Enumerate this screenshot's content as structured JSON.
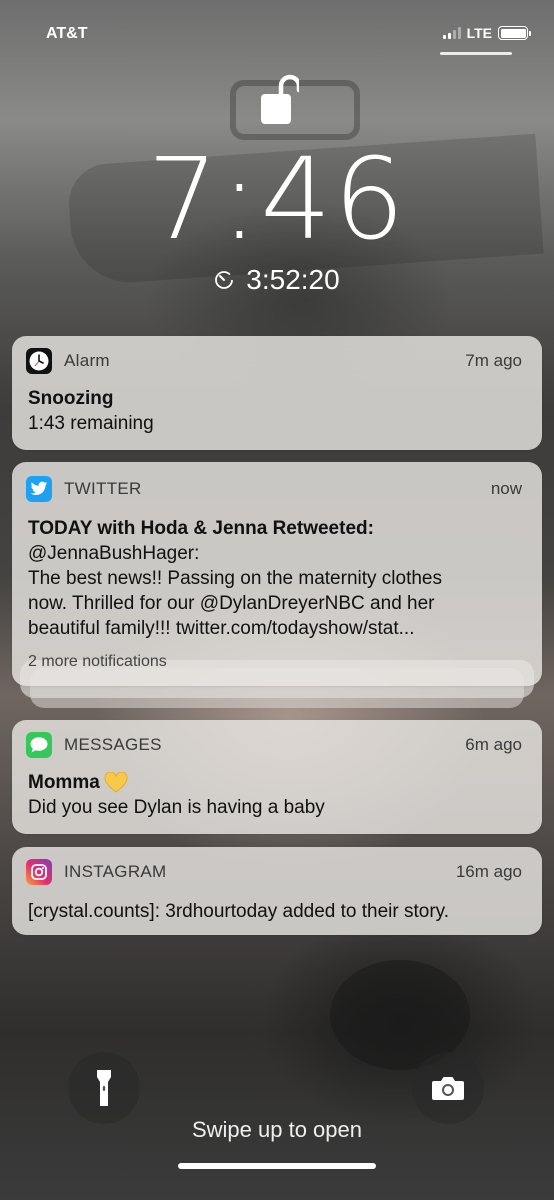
{
  "status_bar": {
    "carrier": "AT&T",
    "network": "LTE",
    "battery_level": 1.0
  },
  "lock_screen": {
    "lock_icon": "unlocked-padlock-icon",
    "time": "7:46",
    "timer_icon": "timer-icon",
    "timer": "3:52:20"
  },
  "notifications": [
    {
      "app": "Alarm",
      "icon": "clock-icon",
      "time": "7m ago",
      "title": "Snoozing",
      "lines": [
        "1:43 remaining"
      ]
    },
    {
      "app": "TWITTER",
      "icon": "twitter-bird-icon",
      "icon_color": "#1DA1F2",
      "time": "now",
      "title": "TODAY with Hoda & Jenna Retweeted:",
      "lines": [
        "@JennaBushHager:",
        "The best news!! Passing on the maternity clothes",
        "now. Thrilled for our @DylanDreyerNBC and her",
        "beautiful family!!! twitter.com/todayshow/stat..."
      ],
      "more": "2 more notifications"
    },
    {
      "app": "MESSAGES",
      "icon": "message-bubble-icon",
      "icon_color": "#34C759",
      "time": "6m ago",
      "title": "Momma",
      "title_emoji": "yellow-heart-icon",
      "lines": [
        "Did you see Dylan is having a baby"
      ]
    },
    {
      "app": "INSTAGRAM",
      "icon": "instagram-camera-icon",
      "time": "16m ago",
      "lines": [
        "[crystal.counts]: 3rdhourtoday added to their story."
      ]
    }
  ],
  "bottom": {
    "flashlight_icon": "flashlight-icon",
    "camera_icon": "camera-icon",
    "swipe_text": "Swipe up to open"
  }
}
